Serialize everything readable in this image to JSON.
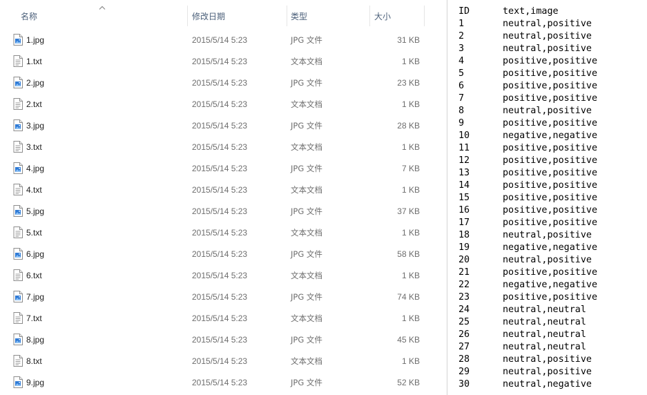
{
  "explorer": {
    "columns": {
      "name": "名称",
      "date": "修改日期",
      "type": "类型",
      "size": "大小"
    },
    "sort_icon": "chevron-up-icon",
    "files": [
      {
        "name": "1.jpg",
        "date": "2015/5/14 5:23",
        "type": "JPG 文件",
        "size": "31 KB",
        "icon": "image-file-icon"
      },
      {
        "name": "1.txt",
        "date": "2015/5/14 5:23",
        "type": "文本文档",
        "size": "1 KB",
        "icon": "text-file-icon"
      },
      {
        "name": "2.jpg",
        "date": "2015/5/14 5:23",
        "type": "JPG 文件",
        "size": "23 KB",
        "icon": "image-file-icon"
      },
      {
        "name": "2.txt",
        "date": "2015/5/14 5:23",
        "type": "文本文档",
        "size": "1 KB",
        "icon": "text-file-icon"
      },
      {
        "name": "3.jpg",
        "date": "2015/5/14 5:23",
        "type": "JPG 文件",
        "size": "28 KB",
        "icon": "image-file-icon"
      },
      {
        "name": "3.txt",
        "date": "2015/5/14 5:23",
        "type": "文本文档",
        "size": "1 KB",
        "icon": "text-file-icon"
      },
      {
        "name": "4.jpg",
        "date": "2015/5/14 5:23",
        "type": "JPG 文件",
        "size": "7 KB",
        "icon": "image-file-icon"
      },
      {
        "name": "4.txt",
        "date": "2015/5/14 5:23",
        "type": "文本文档",
        "size": "1 KB",
        "icon": "text-file-icon"
      },
      {
        "name": "5.jpg",
        "date": "2015/5/14 5:23",
        "type": "JPG 文件",
        "size": "37 KB",
        "icon": "image-file-icon"
      },
      {
        "name": "5.txt",
        "date": "2015/5/14 5:23",
        "type": "文本文档",
        "size": "1 KB",
        "icon": "text-file-icon"
      },
      {
        "name": "6.jpg",
        "date": "2015/5/14 5:23",
        "type": "JPG 文件",
        "size": "58 KB",
        "icon": "image-file-icon"
      },
      {
        "name": "6.txt",
        "date": "2015/5/14 5:23",
        "type": "文本文档",
        "size": "1 KB",
        "icon": "text-file-icon"
      },
      {
        "name": "7.jpg",
        "date": "2015/5/14 5:23",
        "type": "JPG 文件",
        "size": "74 KB",
        "icon": "image-file-icon"
      },
      {
        "name": "7.txt",
        "date": "2015/5/14 5:23",
        "type": "文本文档",
        "size": "1 KB",
        "icon": "text-file-icon"
      },
      {
        "name": "8.jpg",
        "date": "2015/5/14 5:23",
        "type": "JPG 文件",
        "size": "45 KB",
        "icon": "image-file-icon"
      },
      {
        "name": "8.txt",
        "date": "2015/5/14 5:23",
        "type": "文本文档",
        "size": "1 KB",
        "icon": "text-file-icon"
      },
      {
        "name": "9.jpg",
        "date": "2015/5/14 5:23",
        "type": "JPG 文件",
        "size": "52 KB",
        "icon": "image-file-icon"
      }
    ]
  },
  "viewer": {
    "lines": [
      {
        "id": "ID",
        "value": "text,image"
      },
      {
        "id": "1",
        "value": "neutral,positive"
      },
      {
        "id": "2",
        "value": "neutral,positive"
      },
      {
        "id": "3",
        "value": "neutral,positive"
      },
      {
        "id": "4",
        "value": "positive,positive"
      },
      {
        "id": "5",
        "value": "positive,positive"
      },
      {
        "id": "6",
        "value": "positive,positive"
      },
      {
        "id": "7",
        "value": "positive,positive"
      },
      {
        "id": "8",
        "value": "neutral,positive"
      },
      {
        "id": "9",
        "value": "positive,positive"
      },
      {
        "id": "10",
        "value": "negative,negative"
      },
      {
        "id": "11",
        "value": "positive,positive"
      },
      {
        "id": "12",
        "value": "positive,positive"
      },
      {
        "id": "13",
        "value": "positive,positive"
      },
      {
        "id": "14",
        "value": "positive,positive"
      },
      {
        "id": "15",
        "value": "positive,positive"
      },
      {
        "id": "16",
        "value": "positive,positive"
      },
      {
        "id": "17",
        "value": "positive,positive"
      },
      {
        "id": "18",
        "value": "neutral,positive"
      },
      {
        "id": "19",
        "value": "negative,negative"
      },
      {
        "id": "20",
        "value": "neutral,positive"
      },
      {
        "id": "21",
        "value": "positive,positive"
      },
      {
        "id": "22",
        "value": "negative,negative"
      },
      {
        "id": "23",
        "value": "positive,positive"
      },
      {
        "id": "24",
        "value": "neutral,neutral"
      },
      {
        "id": "25",
        "value": "neutral,neutral"
      },
      {
        "id": "26",
        "value": "neutral,neutral"
      },
      {
        "id": "27",
        "value": "neutral,neutral"
      },
      {
        "id": "28",
        "value": "neutral,positive"
      },
      {
        "id": "29",
        "value": "neutral,positive"
      },
      {
        "id": "30",
        "value": "neutral,negative"
      }
    ]
  },
  "colors": {
    "header_text": "#4c607a",
    "name_text": "#1e1e1e",
    "detail_text": "#6d6d6d",
    "image_icon_accent": "#2f7bd6"
  }
}
